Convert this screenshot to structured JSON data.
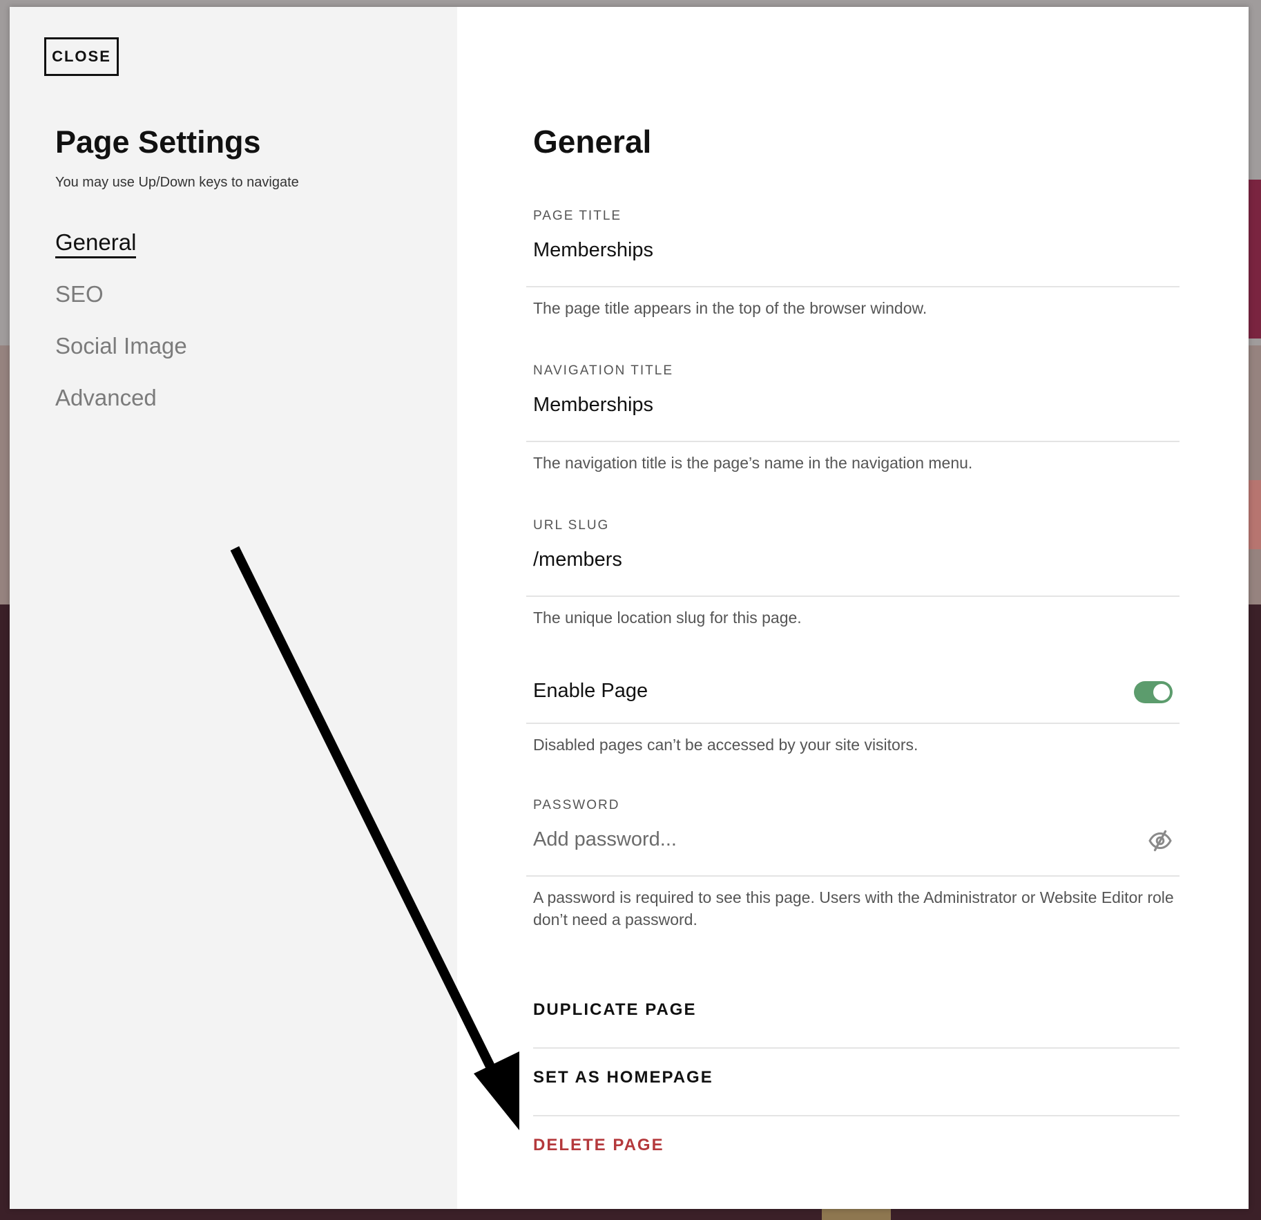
{
  "close_label": "CLOSE",
  "sidebar": {
    "title": "Page Settings",
    "hint": "You may use Up/Down keys to navigate",
    "items": [
      {
        "label": "General",
        "active": true
      },
      {
        "label": "SEO",
        "active": false
      },
      {
        "label": "Social Image",
        "active": false
      },
      {
        "label": "Advanced",
        "active": false
      }
    ]
  },
  "general": {
    "title": "General",
    "page_title": {
      "label": "PAGE TITLE",
      "value": "Memberships",
      "help": "The page title appears in the top of the browser window."
    },
    "navigation_title": {
      "label": "NAVIGATION TITLE",
      "value": "Memberships",
      "help": "The navigation title is the page’s name in the navigation menu."
    },
    "url_slug": {
      "label": "URL SLUG",
      "value": "/members",
      "help": "The unique location slug for this page."
    },
    "enable_page": {
      "label": "Enable Page",
      "enabled": true,
      "help": "Disabled pages can’t be accessed by your site visitors."
    },
    "password": {
      "label": "PASSWORD",
      "placeholder": "Add password...",
      "help": "A password is required to see this page. Users with the Administrator or Website Editor role don’t need a password."
    },
    "actions": {
      "duplicate": "DUPLICATE PAGE",
      "set_homepage": "SET AS HOMEPAGE",
      "delete": "DELETE PAGE"
    }
  },
  "colors": {
    "toggle_on": "#5c9c6d",
    "danger": "#b4393c",
    "sidebar_bg": "#f3f3f3"
  },
  "icons": {
    "password_visibility": "eye-slash-icon",
    "annotation": "arrow-icon"
  }
}
